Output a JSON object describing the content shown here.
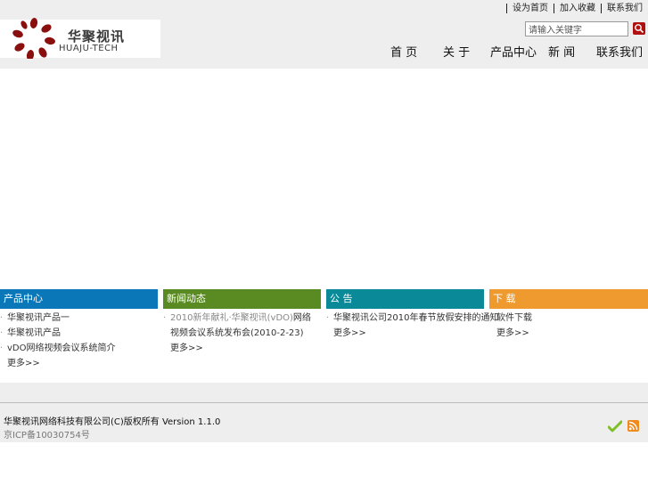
{
  "header": {
    "logo_cn": "华聚视讯",
    "logo_en": "HUAJU-TECH",
    "top_links": [
      "设为首页",
      "加入收藏",
      "联系我们"
    ],
    "search": {
      "value": "请输入关键字"
    }
  },
  "nav": [
    "首  页",
    "关 于",
    "产品中心",
    "新 闻",
    "联系我们"
  ],
  "panels": [
    {
      "title": "产品中心",
      "color": "#0a77b9",
      "items": [
        {
          "text": "华聚视讯产品一"
        },
        {
          "text": "华聚视讯产品"
        },
        {
          "text": "vDO网络视频会议系统简介"
        }
      ],
      "more": "更多>>"
    },
    {
      "title": "新闻动态",
      "color": "#5a8a22",
      "items": [
        {
          "muted": "2010新年献礼·华聚视讯(vDO)",
          "text": "网络视频会议系统发布会",
          "date": "(2010-2-23)"
        }
      ],
      "more": "更多>>"
    },
    {
      "title": "公    告",
      "color": "#0a8a98",
      "items": [
        {
          "text": "华聚视讯公司2010年春节放假安排的通知"
        }
      ],
      "more": "更多>>"
    },
    {
      "title": "下    载",
      "color": "#ee9a2f",
      "items": [
        {
          "text": "软件下载"
        }
      ],
      "more": "更多>>"
    }
  ],
  "footer": {
    "copyright": "华聚视讯网络科技有限公司(C)版权所有 Version 1.1.0",
    "icp": "京ICP备10030754号"
  },
  "icons": {
    "search": "search-icon",
    "check": "check-icon",
    "rss": "rss-icon"
  }
}
